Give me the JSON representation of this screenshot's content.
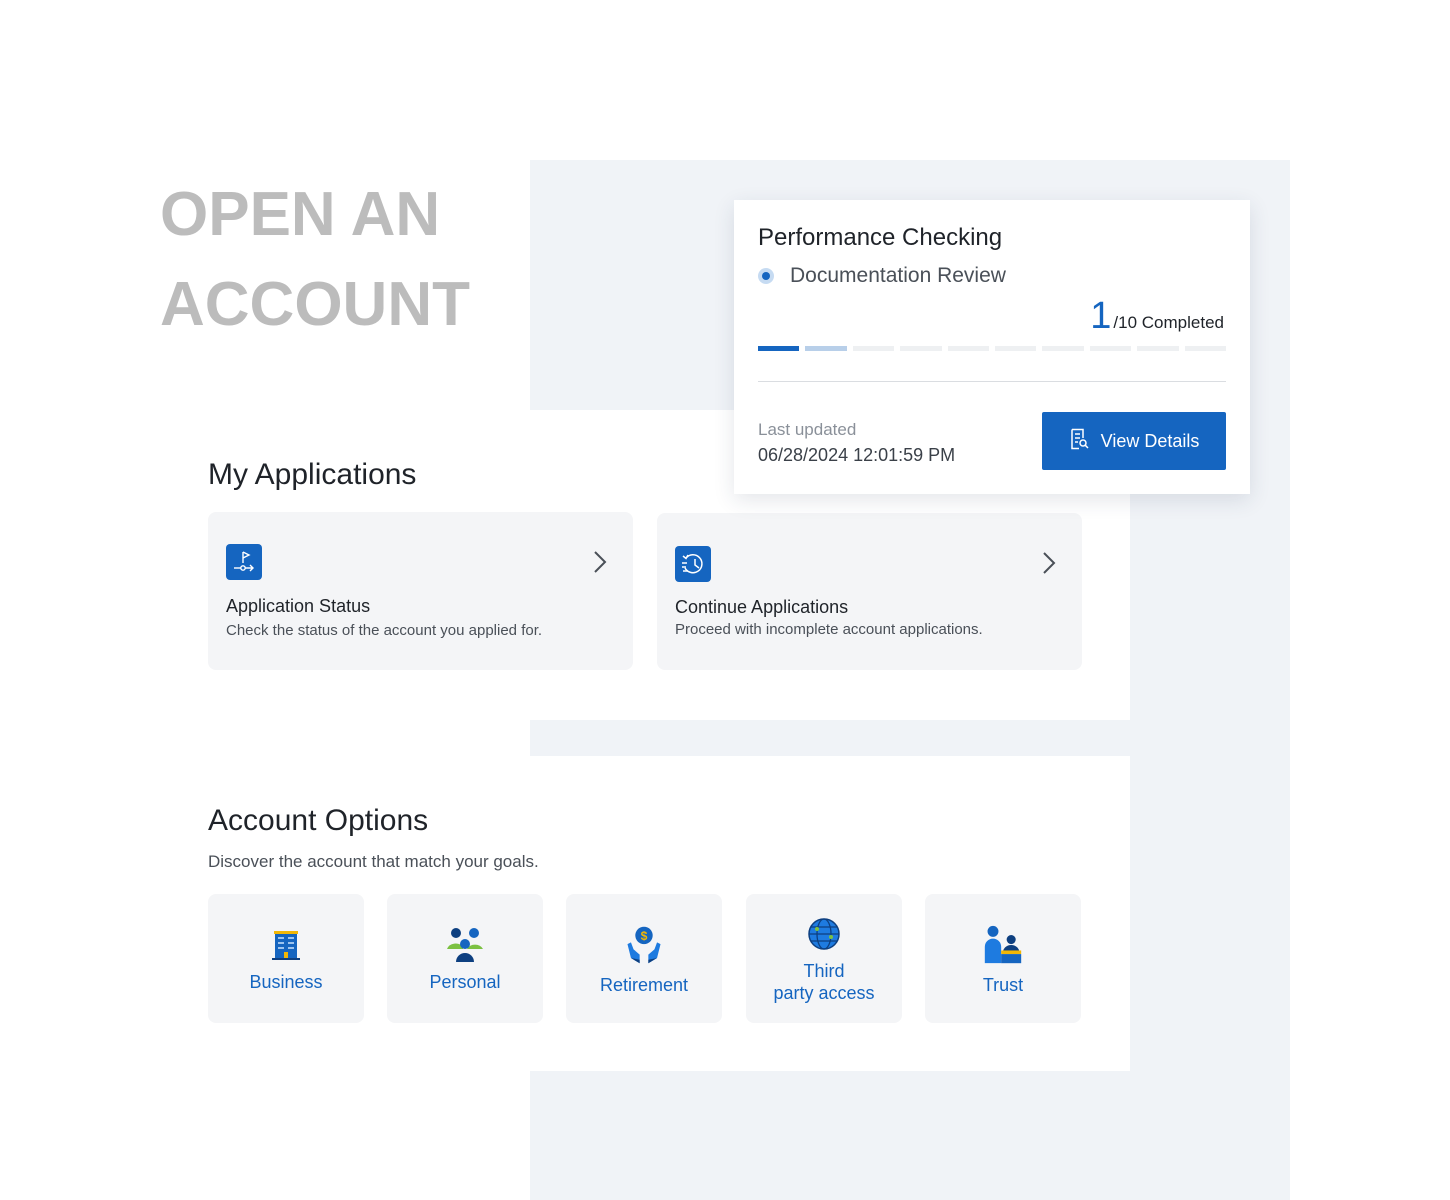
{
  "hero": {
    "title": "OPEN AN ACCOUNT"
  },
  "status_card": {
    "title": "Performance Checking",
    "step_label": "Documentation Review",
    "progress_current": "1",
    "progress_total": "/10 Completed",
    "progress_completed_steps": 1,
    "progress_total_steps": 10,
    "last_updated_label": "Last updated",
    "last_updated_value": "06/28/2024 12:01:59 PM",
    "button_label": "View Details",
    "button_icon": "document-search-icon",
    "accent_color": "#1565c0"
  },
  "applications": {
    "title": "My Applications",
    "cards": [
      {
        "title": "Application Status",
        "description": "Check the status of the account you applied for.",
        "icon": "route-flag-icon"
      },
      {
        "title": "Continue Applications",
        "description": "Proceed with incomplete account applications.",
        "icon": "history-icon"
      }
    ]
  },
  "account_options": {
    "title": "Account Options",
    "subtitle": "Discover the account that match your goals.",
    "options": [
      {
        "label": "Business",
        "icon": "building-icon"
      },
      {
        "label": "Personal",
        "icon": "people-icon"
      },
      {
        "label": "Retirement",
        "icon": "hands-dollar-icon"
      },
      {
        "label": "Third\nparty access",
        "icon": "globe-icon"
      },
      {
        "label": "Trust",
        "icon": "trust-people-icon"
      }
    ]
  }
}
